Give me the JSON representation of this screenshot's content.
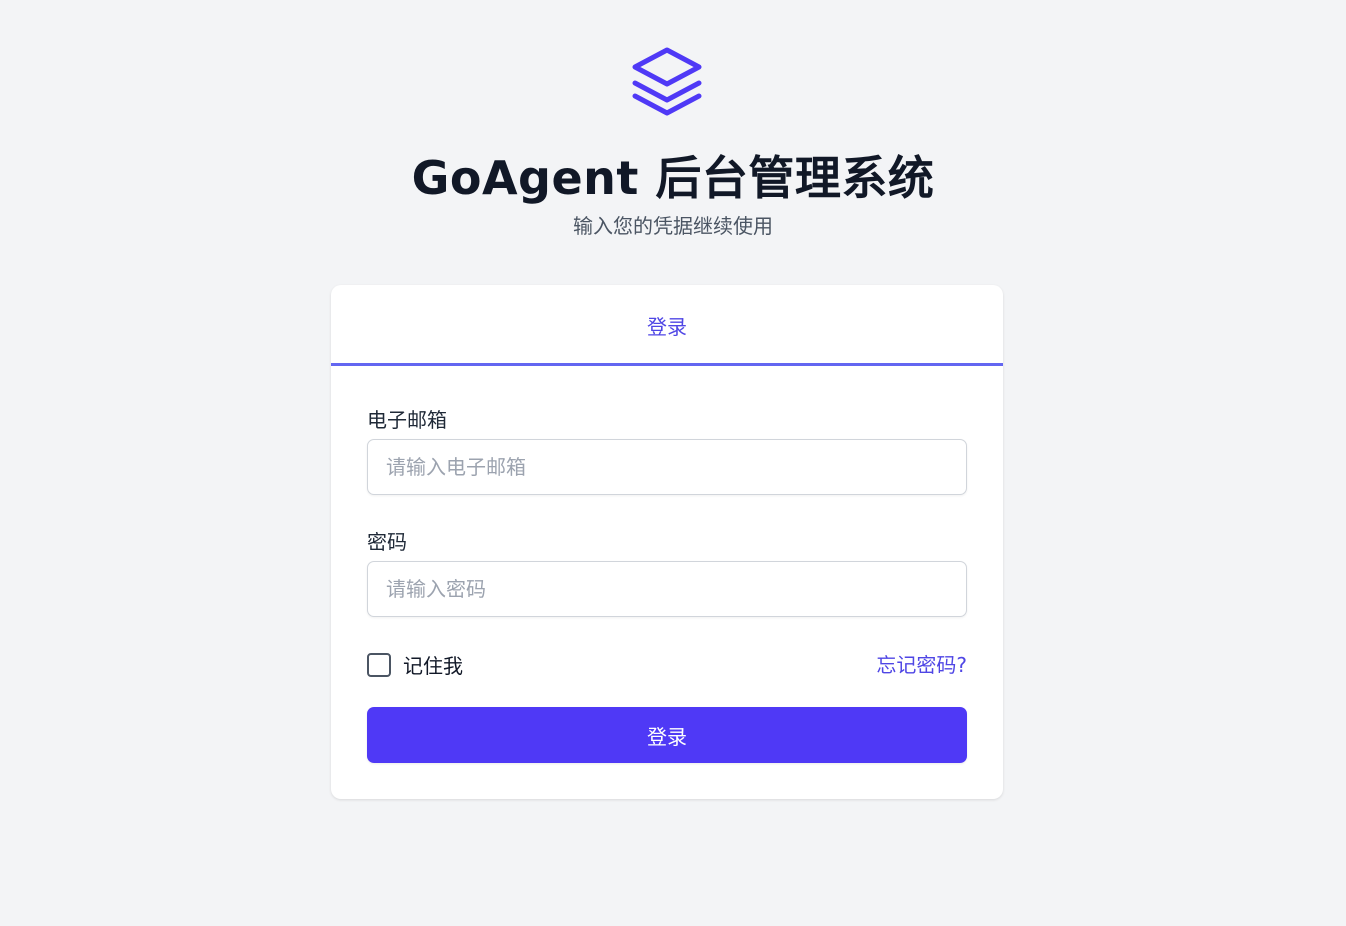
{
  "header": {
    "logo_icon": "layers-icon",
    "title": "GoAgent 后台管理系统",
    "subtitle": "输入您的凭据继续使用"
  },
  "card": {
    "tab_label": "登录",
    "email": {
      "label": "电子邮箱",
      "placeholder": "请输入电子邮箱",
      "value": ""
    },
    "password": {
      "label": "密码",
      "placeholder": "请输入密码",
      "value": ""
    },
    "remember_label": "记住我",
    "remember_checked": false,
    "forgot_label": "忘记密码?",
    "submit_label": "登录"
  },
  "colors": {
    "background": "#f3f4f6",
    "accent": "#4f39f6",
    "accent_text": "#4f46e5",
    "tab_underline": "#6366f1",
    "title": "#111827",
    "subtitle": "#4b5563"
  }
}
